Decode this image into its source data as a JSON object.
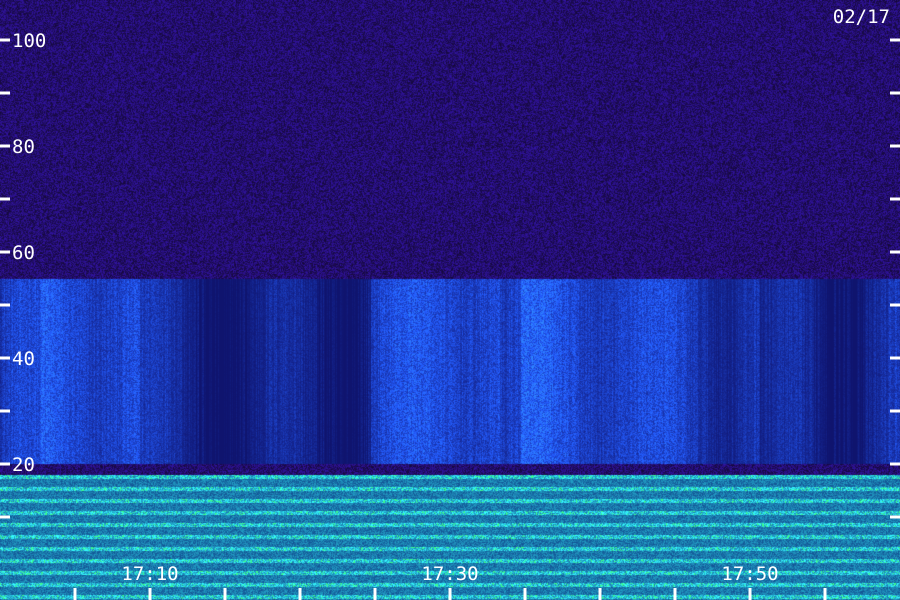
{
  "chart_data": {
    "type": "heatmap",
    "title": "",
    "date_label": "02/17",
    "ylabel": "",
    "xlabel": "",
    "ylim": [
      0,
      100
    ],
    "y_ticks_labeled": [
      20,
      40,
      60,
      80,
      100
    ],
    "y_ticks_minor": [
      10,
      30,
      50,
      70,
      90
    ],
    "x_time_range": [
      "17:00",
      "18:00"
    ],
    "x_ticks_labeled": [
      "17:10",
      "17:30",
      "17:50"
    ],
    "x_ticks_every_minutes": 5,
    "colormap": [
      "#1a0a40",
      "#2a10a0",
      "#1030ff",
      "#00c0ff",
      "#40ff80"
    ],
    "bands": [
      {
        "name": "",
        "y_low": 0,
        "y_high": 18,
        "intensity": "strong"
      },
      {
        "name": "",
        "y_low": 20,
        "y_high": 55,
        "intensity": "moderate"
      }
    ]
  }
}
